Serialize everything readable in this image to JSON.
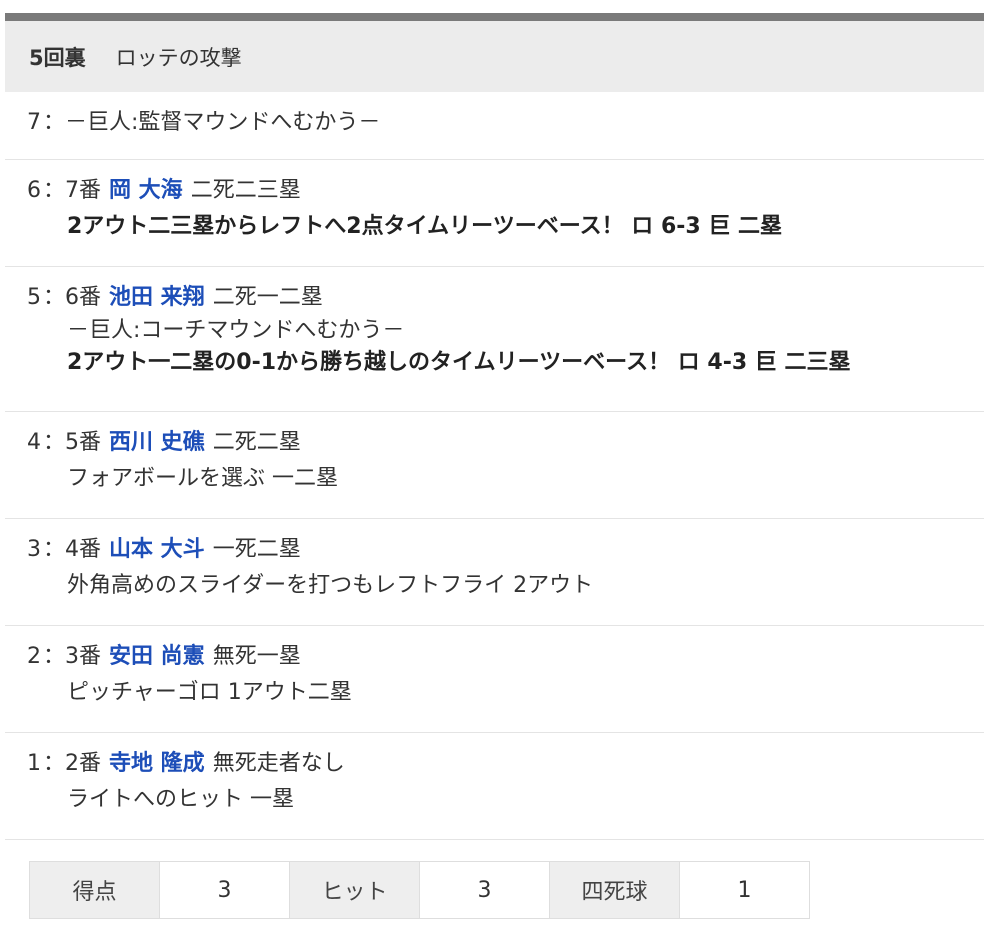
{
  "inning": {
    "label": "5回裏",
    "title": "ロッテの攻撃"
  },
  "events": [
    {
      "number": "7",
      "sep": "：",
      "main_text": "－巨人:監督マウンドへむかう－"
    },
    {
      "number": "6",
      "sep": "：",
      "order": "7番",
      "batter": "岡 大海",
      "situation": "二死二三塁",
      "lines": [
        {
          "text": "2アウト二三塁からレフトへ2点タイムリーツーベース！ ロ 6-3 巨 二塁",
          "bold": true
        }
      ]
    },
    {
      "number": "5",
      "sep": "：",
      "order": "6番",
      "batter": "池田 来翔",
      "situation": "二死一二塁",
      "lines": [
        {
          "text": "－巨人:コーチマウンドへむかう－",
          "bold": false
        },
        {
          "text": "2アウト一二塁の0-1から勝ち越しのタイムリーツーベース！ ロ 4-3 巨 二三塁",
          "bold": true
        }
      ]
    },
    {
      "number": "4",
      "sep": "：",
      "order": "5番",
      "batter": "西川 史礁",
      "situation": "二死二塁",
      "lines": [
        {
          "text": "フォアボールを選ぶ 一二塁",
          "bold": false
        }
      ]
    },
    {
      "number": "3",
      "sep": "：",
      "order": "4番",
      "batter": "山本 大斗",
      "situation": "一死二塁",
      "lines": [
        {
          "text": "外角高めのスライダーを打つもレフトフライ 2アウト",
          "bold": false
        }
      ]
    },
    {
      "number": "2",
      "sep": "：",
      "order": "3番",
      "batter": "安田 尚憲",
      "situation": "無死一塁",
      "lines": [
        {
          "text": "ピッチャーゴロ 1アウト二塁",
          "bold": false
        }
      ]
    },
    {
      "number": "1",
      "sep": "：",
      "order": "2番",
      "batter": "寺地 隆成",
      "situation": "無死走者なし",
      "lines": [
        {
          "text": "ライトへのヒット 一塁",
          "bold": false
        }
      ]
    }
  ],
  "stats": [
    {
      "label": "得点",
      "value": "3"
    },
    {
      "label": "ヒット",
      "value": "3"
    },
    {
      "label": "四死球",
      "value": "1"
    }
  ],
  "colors": {
    "batter_link": "#1d4eb8",
    "header_bg": "#ececec",
    "top_rule": "#7a7a7a"
  }
}
